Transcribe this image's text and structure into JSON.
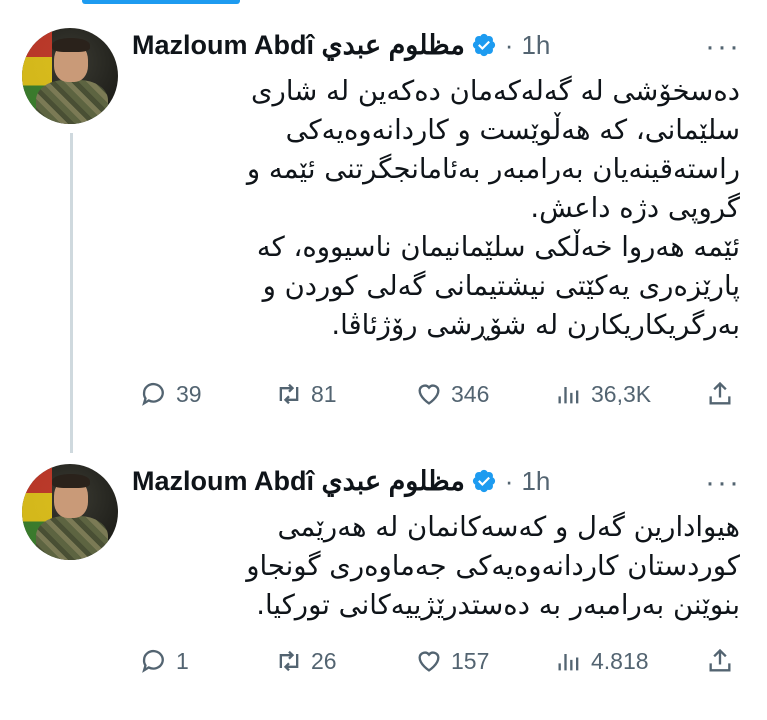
{
  "tweets": [
    {
      "name": "Mazloum Abdî مظلوم عبدي",
      "separator": "·",
      "time": "1h",
      "more": "···",
      "lines": [
        "دەسخۆشی لە گەلەکەمان دەکەین لە شاری",
        "سلێمانی، کە هەڵوێست و کاردانەوەیەکی",
        "راستەقینەیان بەرامبەر بەئامانجگرتنی ئێمە و",
        "گروپی دژە داعش.",
        "ئێمە هەروا خەڵکی سلێمانیمان ناسیووە، کە",
        "پارێزەری یەکێتی نیشتیمانی گەلی کوردن و",
        "بەرگریکاریکارن لە شۆڕشی رۆژئاڤا."
      ],
      "replies": "39",
      "retweets": "81",
      "likes": "346",
      "views": "36,3K"
    },
    {
      "name": "Mazloum Abdî مظلوم عبدي",
      "separator": "·",
      "time": "1h",
      "more": "···",
      "lines": [
        "هیوادارین  گەل و کەسەکانمان لە هەرێمی",
        "کوردستان کاردانەوەیەکی جەماوەری گونجاو",
        "بنوێنن بەرامبەر بە دەستدرێژییەکانی تورکیا."
      ],
      "replies": "1",
      "retweets": "26",
      "likes": "157",
      "views": "4.818"
    }
  ],
  "icons": {
    "verified": "verified-badge-icon",
    "reply": "reply-icon",
    "retweet": "retweet-icon",
    "like": "heart-icon",
    "views": "views-icon",
    "share": "share-icon"
  },
  "colors": {
    "accent": "#1d9bf0",
    "muted": "#536471",
    "text": "#0f1419",
    "line": "#cfd9de"
  }
}
